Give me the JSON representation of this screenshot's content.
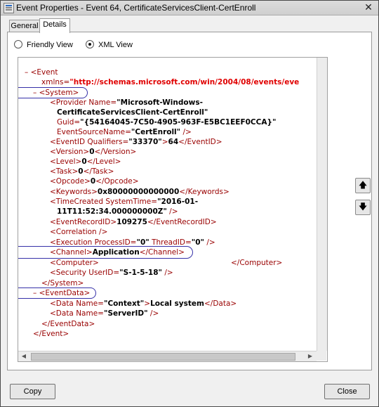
{
  "window": {
    "title": "Event Properties - Event 64, CertificateServicesClient-CertEnroll",
    "close_glyph": "✕",
    "icon": "event-properties-icon"
  },
  "tabs": [
    {
      "label": "General"
    },
    {
      "label": "Details",
      "selected": true
    }
  ],
  "view_options": {
    "friendly": {
      "label": "Friendly View",
      "selected": false
    },
    "xml": {
      "label": "XML View",
      "selected": true
    }
  },
  "xml": {
    "event_open": "Event",
    "xmlns_attr": "xmlns=",
    "xmlns_value": "\"http://schemas.microsoft.com/win/2004/08/events/eve",
    "system_open": "<System>",
    "provider_name_attr": "<Provider Name=",
    "provider_name_val1": "\"Microsoft-Windows-",
    "provider_name_val2": "CertificateServicesClient-CertEnroll\"",
    "guid_attr": "Guid=",
    "guid_val": "\"{54164045-7C50-4905-963F-E5BC1EEF0CCA}\"",
    "eventsource_attr": "EventSourceName=",
    "eventsource_val": "\"CertEnroll\"",
    "eventsource_close": " />",
    "eventid_open": "<EventID Qualifiers=",
    "eventid_qual": "\"33370\"",
    "eventid_gt": ">",
    "eventid_val": "64",
    "eventid_close": "</EventID>",
    "version_open": "<Version>",
    "version_val": "0",
    "version_close": "</Version>",
    "level_open": "<Level>",
    "level_val": "0",
    "level_close": "</Level>",
    "task_open": "<Task>",
    "task_val": "0",
    "task_close": "</Task>",
    "opcode_open": "<Opcode>",
    "opcode_val": "0",
    "opcode_close": "</Opcode>",
    "keywords_open": "<Keywords>",
    "keywords_val": "0x80000000000000",
    "keywords_close": "</Keywords>",
    "timecreated_attr": "<TimeCreated SystemTime=",
    "timecreated_val1": "\"2016-01-",
    "timecreated_val2": "11T11:52:34.000000000Z\"",
    "timecreated_close": " />",
    "recordid_open": "<EventRecordID>",
    "recordid_val": "109275",
    "recordid_close": "</EventRecordID>",
    "correlation": "<Correlation />",
    "execution_attr": "<Execution ProcessID=",
    "execution_pid": "\"0\"",
    "execution_tid_attr": " ThreadID=",
    "execution_tid": "\"0\"",
    "execution_close": " />",
    "channel_open": "<Channel>",
    "channel_val": "Application",
    "channel_close": "</Channel>",
    "computer_open": "<Computer>",
    "computer_close": "</Computer>",
    "security_attr": "<Security UserID=",
    "security_val": "\"S-1-5-18\"",
    "security_close": " />",
    "system_close": "</System>",
    "eventdata_open": "<EventData>",
    "data1_attr": "<Data Name=",
    "data1_name": "\"Context\"",
    "data1_gt": ">",
    "data1_val": "Local system",
    "data1_close": "</Data>",
    "data2_attr": "<Data Name=",
    "data2_name": "\"ServerID\"",
    "data2_close": " />",
    "eventdata_close": "</EventData>",
    "event_close": "</Event>",
    "collapse_glyph": "–"
  },
  "nav": {
    "up_glyph": "🡅",
    "down_glyph": "🡇"
  },
  "buttons": {
    "copy": "Copy",
    "close": "Close"
  },
  "colors": {
    "tag": "#990000",
    "namespace": "#e00000",
    "highlight": "#3530a8"
  }
}
